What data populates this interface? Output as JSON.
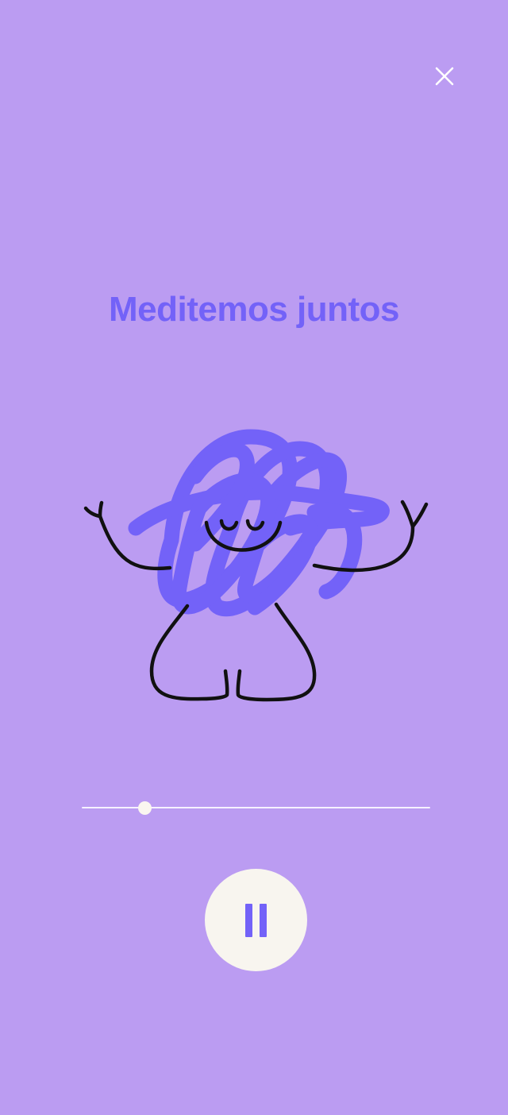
{
  "screen": {
    "background_color": "#bb9cf2",
    "accent_color": "#7362f8"
  },
  "header": {
    "close_icon": "close-icon"
  },
  "main": {
    "title": "Meditemos juntos",
    "illustration_icon": "meditating-character-illustration"
  },
  "player": {
    "progress_fraction": 0.18,
    "pause_icon": "pause-icon"
  }
}
